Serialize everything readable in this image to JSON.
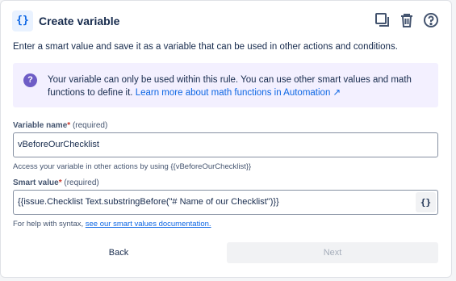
{
  "header": {
    "icon_glyph": "{}",
    "title": "Create variable",
    "actions": [
      "duplicate-icon",
      "trash-icon",
      "help-icon"
    ]
  },
  "intro": "Enter a smart value and save it as a variable that can be used in other actions and conditions.",
  "info": {
    "icon": "question-icon",
    "text": "Your variable can only be used within this rule. You can use other smart values and math functions to define it.",
    "link": "Learn more about math functions in Automation ↗"
  },
  "variable_name": {
    "label": "Variable name",
    "asterisk": "*",
    "required": "(required)",
    "value": "vBeforeOurChecklist",
    "help": "Access your variable in other actions by using {{vBeforeOurChecklist}}"
  },
  "smart_value": {
    "label": "Smart value",
    "asterisk": "*",
    "required": "(required)",
    "value": "{{issue.Checklist Text.substringBefore(\"# Name of our Checklist\")}}",
    "button_glyph": "{}",
    "help_prefix": "For help with syntax,",
    "help_link": "see our smart values documentation."
  },
  "footer": {
    "back": "Back",
    "next": "Next"
  },
  "colors": {
    "accent": "#0c66e4",
    "info_bg": "#f3f0ff",
    "info_icon": "#6e5dc6",
    "required_asterisk": "#c9372c"
  }
}
